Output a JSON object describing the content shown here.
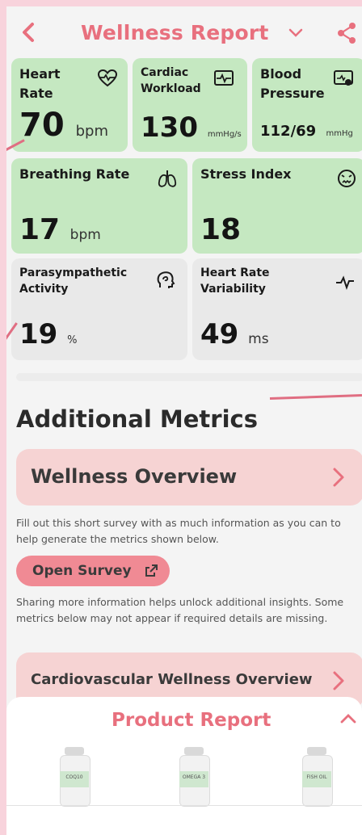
{
  "header": {
    "title": "Wellness Report",
    "icons": {
      "back": "chevron-left-icon",
      "dropdown": "chevron-down-icon",
      "share": "share-icon"
    }
  },
  "metrics": {
    "heart_rate": {
      "label": "Heart Rate",
      "value": "70",
      "unit": "bpm",
      "icon": "heartbeat-icon"
    },
    "cardiac_workload": {
      "label": "Cardiac Workload",
      "value": "130",
      "unit": "mmHg/s",
      "icon": "ecg-monitor-icon"
    },
    "blood_pressure": {
      "label": "Blood Pressure",
      "value": "112/69",
      "unit": "mmHg",
      "icon": "blood-pressure-icon"
    },
    "breathing_rate": {
      "label": "Breathing Rate",
      "value": "17",
      "unit": "bpm",
      "icon": "lungs-icon"
    },
    "stress_index": {
      "label": "Stress Index",
      "value": "18",
      "unit": "",
      "icon": "stressed-face-icon"
    },
    "parasympathetic": {
      "label": "Parasympathetic Activity",
      "value": "19",
      "unit": "%",
      "icon": "head-brain-icon"
    },
    "hrv": {
      "label": "Heart Rate Variability",
      "value": "49",
      "unit": "ms",
      "icon": "pulse-wave-icon"
    }
  },
  "additional": {
    "title": "Additional Metrics",
    "wellness_overview": "Wellness Overview",
    "survey_note": "Fill out this short survey with as much information as you can to help generate the metrics shown below.",
    "open_survey": "Open Survey",
    "sharing_note": "Sharing more information helps unlock additional insights. Some metrics below may not appear if required details are missing.",
    "cardio_overview": "Cardiovascular Wellness Overview"
  },
  "product_report": {
    "title": "Product Report",
    "products": [
      "COQ10",
      "OMEGA 3",
      "FISH OIL"
    ]
  },
  "colors": {
    "accent_pink": "#e8707e",
    "card_green": "#c5e8c1",
    "card_gray": "#e9e9e9",
    "overview_pink": "#f6d3d3",
    "button_pink": "#f08a94",
    "frame_pink": "#f8d3dc"
  }
}
